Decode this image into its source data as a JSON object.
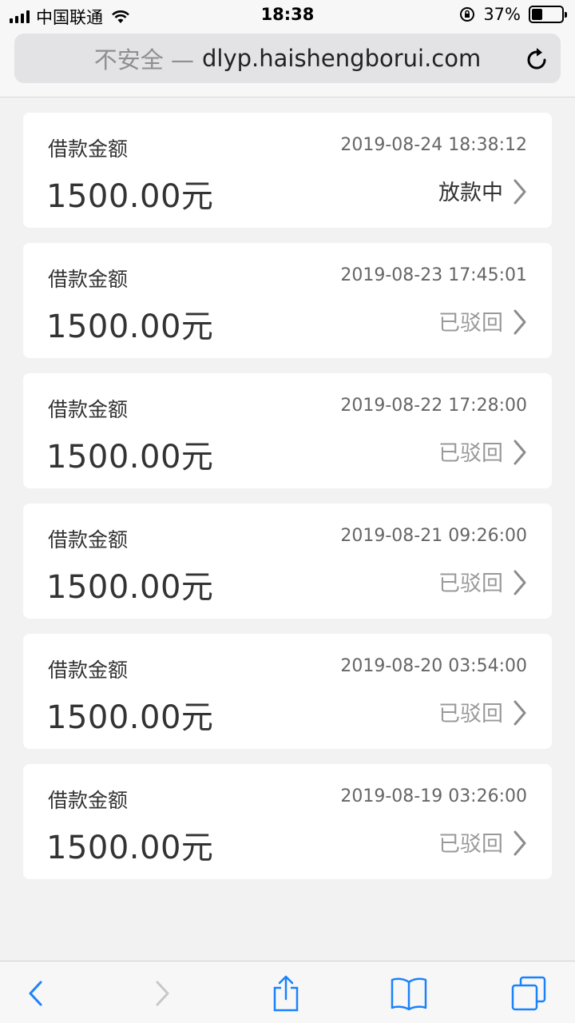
{
  "status_bar": {
    "carrier": "中国联通",
    "time": "18:38",
    "battery": "37%",
    "battery_level": 0.37
  },
  "address_bar": {
    "security": "不安全 —",
    "url": "dlyp.haishengborui.com"
  },
  "loans": [
    {
      "label": "借款金额",
      "date": "2019-08-24 18:38:12",
      "amount": "1500.00元",
      "status": "放款中"
    },
    {
      "label": "借款金额",
      "date": "2019-08-23 17:45:01",
      "amount": "1500.00元",
      "status": "已驳回"
    },
    {
      "label": "借款金额",
      "date": "2019-08-22 17:28:00",
      "amount": "1500.00元",
      "status": "已驳回"
    },
    {
      "label": "借款金额",
      "date": "2019-08-21 09:26:00",
      "amount": "1500.00元",
      "status": "已驳回"
    },
    {
      "label": "借款金额",
      "date": "2019-08-20 03:54:00",
      "amount": "1500.00元",
      "status": "已驳回"
    },
    {
      "label": "借款金额",
      "date": "2019-08-19 03:26:00",
      "amount": "1500.00元",
      "status": "已驳回"
    }
  ],
  "colors": {
    "accent": "#1a82fb",
    "disabled": "#c7c7cc"
  }
}
